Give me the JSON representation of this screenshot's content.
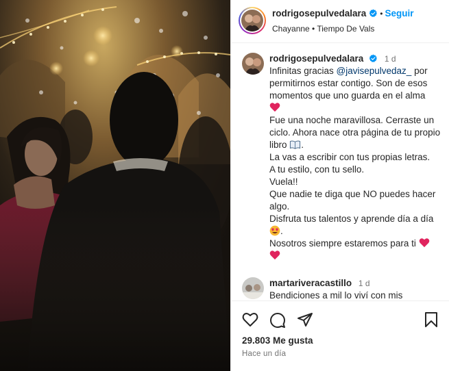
{
  "post": {
    "username": "rodrigosepulvedalara",
    "follow_label": "Seguir",
    "separator": "•",
    "music": "Chayanne • Tiempo De Vals"
  },
  "caption": {
    "username": "rodrigosepulvedalara",
    "time": "1 d",
    "line1_pre": "Infinitas gracias ",
    "mention": "@javisepulvedaz_",
    "line1_post": " por permitirnos estar contigo. Son de esos momentos que uno guarda en el alma",
    "line2": "Fue una noche maravillosa. Cerraste un ciclo. Ahora nace otra página de tu propio libro",
    "line3": "La vas a escribir con tus propias letras.",
    "line4": "A tu estilo, con tu sello.",
    "line5": "Vuela!!",
    "line6": "Que nadie te diga que NO puedes hacer algo.",
    "line7": "Disfruta tus talentos y aprende día a día",
    "line8": "Nosotros siempre estaremos para ti"
  },
  "comment": {
    "username": "martariveracastillo",
    "time": "1 d",
    "text": "Bendiciones a mil lo viví con mis"
  },
  "stats": {
    "likes": "29.803 Me gusta",
    "time_ago": "Hace un día"
  },
  "icons": {
    "like": "heart-icon",
    "comment": "comment-icon",
    "share": "share-icon",
    "save": "bookmark-icon",
    "verified": "verified-badge-icon"
  },
  "colors": {
    "accent": "#0095f6",
    "mention": "#00376b",
    "verified": "#0095f6",
    "heart_emoji": "#e0245e"
  }
}
